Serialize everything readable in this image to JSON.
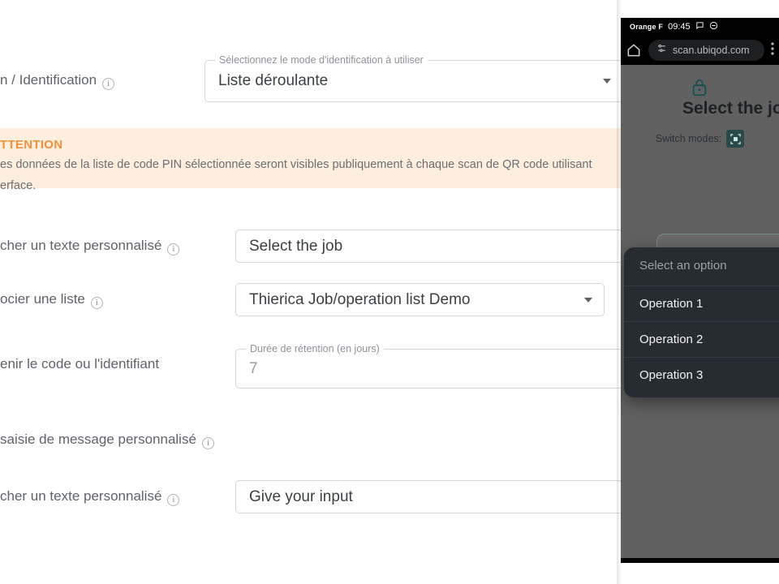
{
  "form": {
    "rows": [
      {
        "label": "n / Identification",
        "has_info": true,
        "field": {
          "legend": "Sélectionnez le mode d'identification à utiliser",
          "value": "Liste déroulante",
          "kind": "select"
        }
      },
      {
        "label": "cher un texte personnalisé",
        "has_info": true,
        "field": {
          "legend": "",
          "value": "Select the job",
          "kind": "text"
        }
      },
      {
        "label": "ocier une liste",
        "has_info": true,
        "field": {
          "legend": "",
          "value": "Thierica Job/operation list Demo",
          "kind": "select"
        }
      },
      {
        "label": "enir le code ou l'identifiant",
        "has_info": false,
        "field": {
          "legend": "Durée de rétention (en jours)",
          "value": "7",
          "kind": "number"
        }
      },
      {
        "label": " saisie de message personnalisé",
        "has_info": true,
        "field": null
      },
      {
        "label": "cher un texte personnalisé",
        "has_info": true,
        "field": {
          "legend": "",
          "value": "Give your input",
          "kind": "text"
        }
      }
    ],
    "attention": {
      "title": "TTENTION",
      "line1": "es données de la liste de code PIN sélectionnée seront visibles publiquement à chaque scan de QR code utilisant",
      "line2": "erface."
    },
    "colors": {
      "attention_bg": "#fdeedd",
      "attention_text": "#f2913d",
      "label": "#5f6368"
    }
  },
  "phone": {
    "status": {
      "carrier": "Orange F",
      "clock": "09:45",
      "icons": [
        "chat-bubble-icon",
        "do-not-disturb-icon"
      ]
    },
    "browser": {
      "home_icon": "home-icon",
      "tune_icon": "page-settings-icon",
      "url": "scan.ubiqod.com",
      "menu_icon": "more-icon"
    },
    "page": {
      "lock_icon": "lock-icon",
      "title": "Select the job",
      "switch_label": "Switch modes:",
      "qr_icon": "qr-code-icon",
      "select_placeholder": ""
    },
    "dropdown": {
      "placeholder": "Select an option",
      "options": [
        "Operation 1",
        "Operation 2",
        "Operation 3"
      ]
    },
    "navbar": {
      "recents": "|||",
      "home": "home-square-icon"
    },
    "colors": {
      "scrim": "#616161",
      "sheet_bg": "#272c33",
      "accent": "#2a4a4a"
    }
  }
}
